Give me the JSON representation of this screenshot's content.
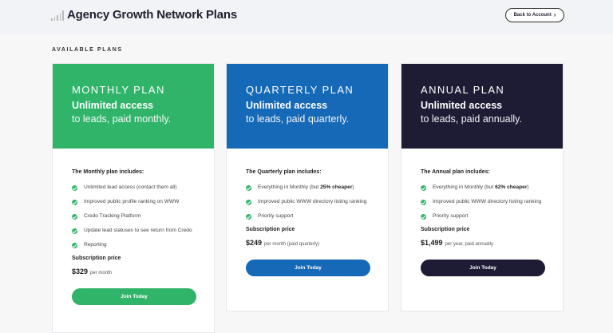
{
  "header": {
    "title": "Agency Growth Network Plans",
    "back_label": "Back to Account",
    "back_icon": "chevron-right-icon"
  },
  "section_label": "AVAILABLE PLANS",
  "plans": [
    {
      "name": "MONTHLY PLAN",
      "headline": "Unlimited access",
      "subline": "to leads, paid monthly.",
      "color": "#30b46a",
      "includes_title": "The Monthly plan includes:",
      "features": [
        {
          "pre": "Unlimited lead access (contact them all)",
          "bold": "",
          "post": ""
        },
        {
          "pre": "Improved public profile ranking on WWW",
          "bold": "",
          "post": ""
        },
        {
          "pre": "Credo Tracking Platform",
          "bold": "",
          "post": ""
        },
        {
          "pre": "Update lead statuses to see return from Credo",
          "bold": "",
          "post": ""
        },
        {
          "pre": "Reporting",
          "bold": "",
          "post": ""
        }
      ],
      "subscription_label": "Subscription price",
      "price": "$329",
      "price_period": "per month",
      "cta": "Join Today"
    },
    {
      "name": "QUARTERLY PLAN",
      "headline": "Unlimited access",
      "subline": "to leads, paid quarterly.",
      "color": "#1569b6",
      "includes_title": "The Quarterly plan includes:",
      "features": [
        {
          "pre": "Everything in Monthly (but ",
          "bold": "25% cheaper",
          "post": ")"
        },
        {
          "pre": "Improved public WWW directory listing ranking",
          "bold": "",
          "post": ""
        },
        {
          "pre": "Priority support",
          "bold": "",
          "post": ""
        }
      ],
      "subscription_label": "Subscription price",
      "price": "$249",
      "price_period": "per month (paid quarterly)",
      "cta": "Join Today"
    },
    {
      "name": "ANNUAL PLAN",
      "headline": "Unlimited access",
      "subline": "to leads, paid annually.",
      "color": "#1e1b35",
      "includes_title": "The Annual plan includes:",
      "features": [
        {
          "pre": "Everything in Monthly (but ",
          "bold": "62% cheaper",
          "post": ")"
        },
        {
          "pre": "Improved public WWW directory listing ranking",
          "bold": "",
          "post": ""
        },
        {
          "pre": "Priority support",
          "bold": "",
          "post": ""
        }
      ],
      "subscription_label": "Subscription price",
      "price": "$1,499",
      "price_period": "per year, paid annually",
      "cta": "Join Today"
    }
  ]
}
